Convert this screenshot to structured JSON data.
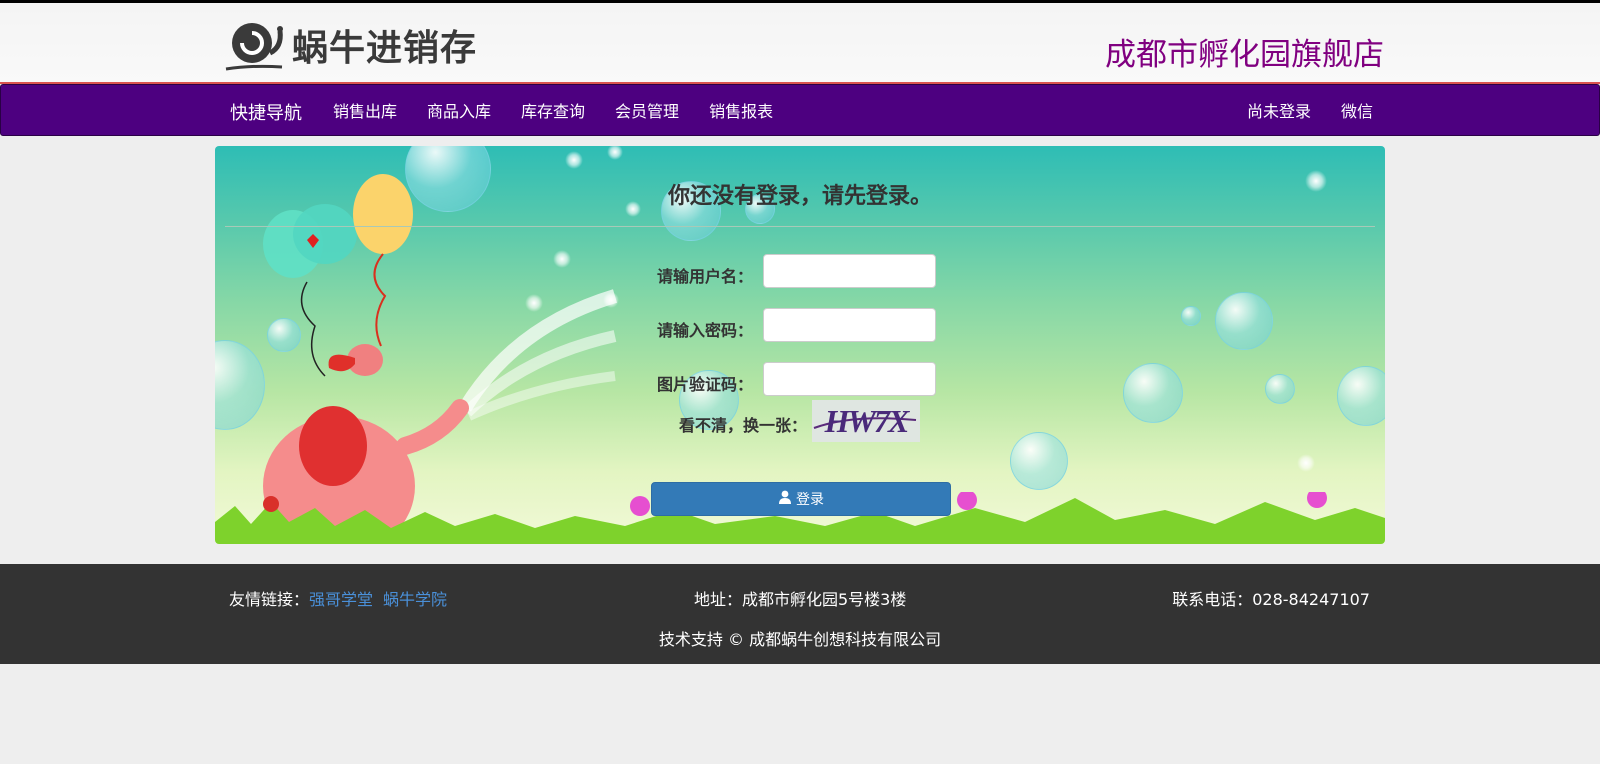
{
  "header": {
    "logo_text": "蜗牛进销存",
    "shop_name": "成都市孵化园旗舰店"
  },
  "nav": {
    "brand": "快捷导航",
    "items": [
      "销售出库",
      "商品入库",
      "库存查询",
      "会员管理",
      "销售报表"
    ],
    "right_items": [
      "尚未登录",
      "微信"
    ]
  },
  "login": {
    "title": "你还没有登录，请先登录。",
    "username_label": "请输用户名：",
    "password_label": "请输入密码：",
    "captcha_label": "图片验证码：",
    "refresh_label": "看不清，换一张：",
    "captcha_text": "HW7X",
    "submit_label": "登录",
    "username_value": "",
    "password_value": "",
    "captcha_value": ""
  },
  "footer": {
    "links_label": "友情链接：",
    "links": [
      "强哥学堂",
      "蜗牛学院"
    ],
    "address": "地址：成都市孵化园5号楼3楼",
    "phone": "联系电话：028-84247107",
    "copyright": "技术支持 © 成都蜗牛创想科技有限公司"
  },
  "colors": {
    "nav_bg": "#4d0080",
    "shop_name": "#800080",
    "button": "#337ab7",
    "footer_bg": "#333333",
    "link": "#4a90d9"
  }
}
